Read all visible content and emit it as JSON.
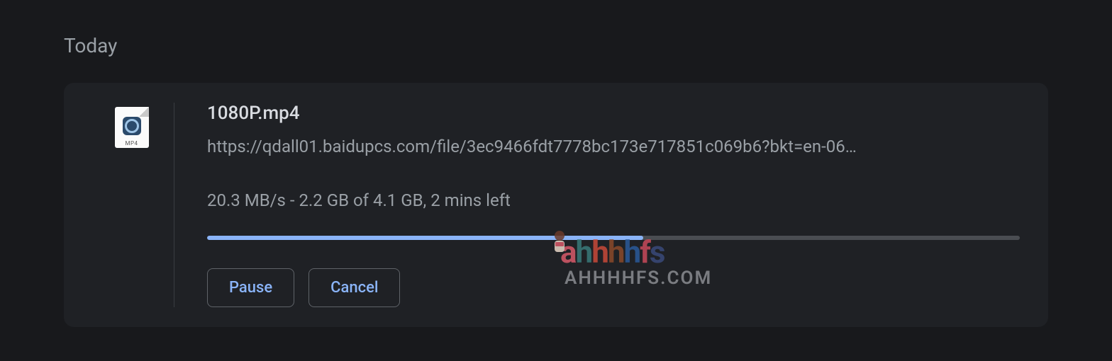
{
  "section_header": "Today",
  "download": {
    "icon_ext": "MP4",
    "file_name": "1080P.mp4",
    "url": "https://qdall01.baidupcs.com/file/3ec9466fdt7778bc173e717851c069b6?bkt=en-06…",
    "status": "20.3 MB/s - 2.2 GB of 4.1 GB, 2 mins left",
    "progress_percent": 53.7,
    "actions": {
      "pause": "Pause",
      "cancel": "Cancel"
    }
  },
  "watermark": {
    "brand": "ahhhhfs",
    "site": "AHHHHFS.COM"
  }
}
